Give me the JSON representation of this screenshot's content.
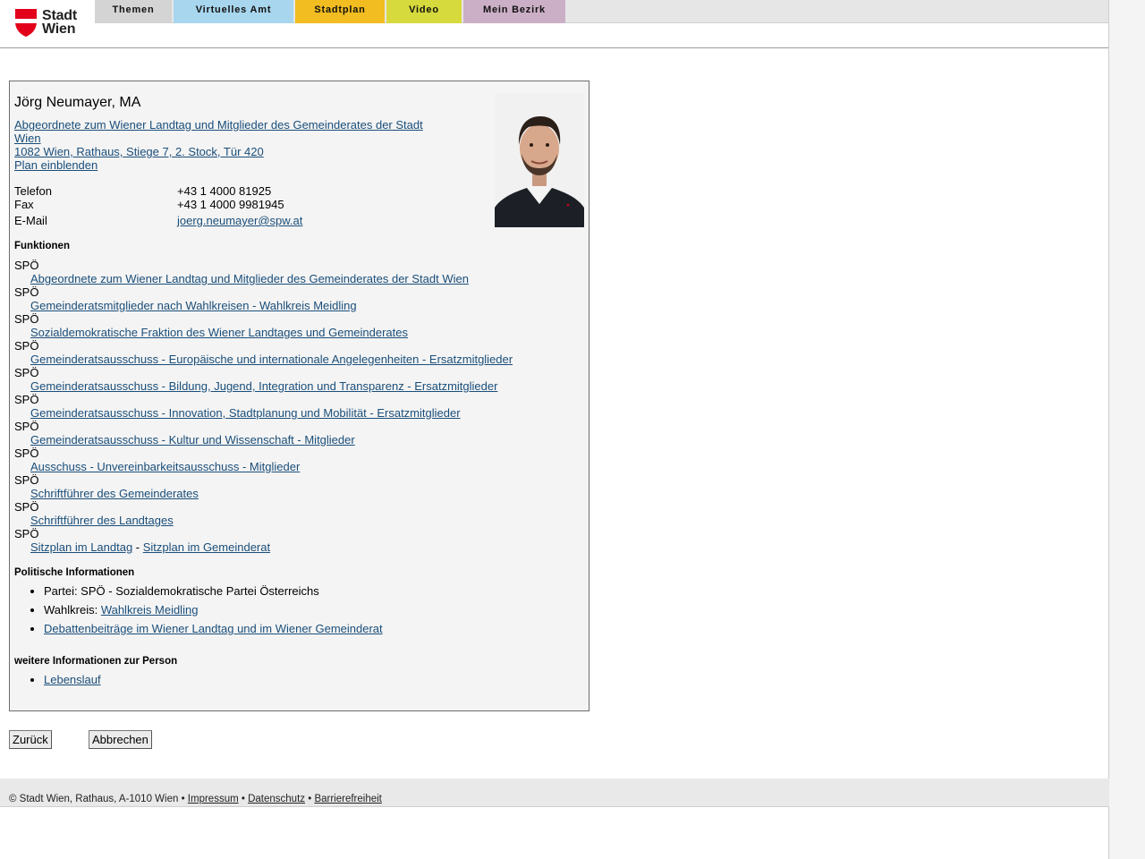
{
  "logo": {
    "line1": "Stadt",
    "line2": "Wien"
  },
  "nav": {
    "tabs": [
      {
        "label": "Themen",
        "color": "#d4d4d4"
      },
      {
        "label": "Virtuelles Amt",
        "color": "#a8d6ee"
      },
      {
        "label": "Stadtplan",
        "color": "#f2bd21"
      },
      {
        "label": "Video",
        "color": "#d6da3c"
      },
      {
        "label": "Mein Bezirk",
        "color": "#cbafc6"
      }
    ]
  },
  "person": {
    "name": "Jörg Neumayer, MA",
    "role_link_line1": "Abgeordnete zum Wiener Landtag und Mitglieder des Gemeinderates der Stadt",
    "role_link_line2": "Wien ",
    "address": "1082 Wien, Rathaus, Stiege 7, 2. Stock, Tür 420",
    "map_link": "Plan einblenden",
    "contact": {
      "phone_label": "Telefon",
      "phone": "+43 1 4000 81925",
      "fax_label": "Fax",
      "fax": "+43 1 4000 9981945",
      "email_label": "E-Mail",
      "email": "joerg.neumayer@spw.at"
    }
  },
  "functions": {
    "heading": "Funktionen",
    "items": [
      {
        "party": "SPÖ",
        "link": "Abgeordnete zum Wiener Landtag und Mitglieder des Gemeinderates der Stadt Wien"
      },
      {
        "party": "SPÖ",
        "link": "Gemeinderatsmitglieder nach Wahlkreisen - Wahlkreis Meidling"
      },
      {
        "party": "SPÖ",
        "link": "Sozialdemokratische Fraktion des Wiener Landtages und Gemeinderates"
      },
      {
        "party": "SPÖ",
        "link": "Gemeinderatsausschuss - Europäische und internationale Angelegenheiten - Ersatzmitglieder"
      },
      {
        "party": "SPÖ",
        "link": "Gemeinderatsausschuss - Bildung, Jugend, Integration und Transparenz - Ersatzmitglieder"
      },
      {
        "party": "SPÖ",
        "link": "Gemeinderatsausschuss - Innovation, Stadtplanung und Mobilität - Ersatzmitglieder"
      },
      {
        "party": "SPÖ",
        "link": "Gemeinderatsausschuss - Kultur und Wissenschaft - Mitglieder"
      },
      {
        "party": "SPÖ",
        "link": "Ausschuss - Unvereinbarkeitsausschuss - Mitglieder"
      },
      {
        "party": "SPÖ",
        "link": "Schriftführer des Gemeinderates"
      },
      {
        "party": "SPÖ",
        "link": "Schriftführer des Landtages"
      }
    ],
    "last_party": "SPÖ",
    "seat_landtag": "Sitzplan im Landtag",
    "seat_sep": " - ",
    "seat_gemeinderat": "Sitzplan im Gemeinderat"
  },
  "political": {
    "heading": "Politische Informationen",
    "party_text": "Partei: SPÖ - Sozialdemokratische Partei Österreichs",
    "district_label": "Wahlkreis: ",
    "district_link": "Wahlkreis Meidling",
    "debate_link": "Debattenbeiträge im Wiener Landtag und im Wiener Gemeinderat"
  },
  "more": {
    "heading": "weitere Informationen zur Person",
    "cv_link": "Lebenslauf"
  },
  "buttons": {
    "back": "Zurück",
    "cancel": "Abbrechen"
  },
  "footer": {
    "copyright": "© Stadt Wien, Rathaus, A-1010 Wien",
    "sep": " • ",
    "impressum": "Impressum",
    "datenschutz": "Datenschutz",
    "barrierefreiheit": "Barrierefreiheit"
  }
}
